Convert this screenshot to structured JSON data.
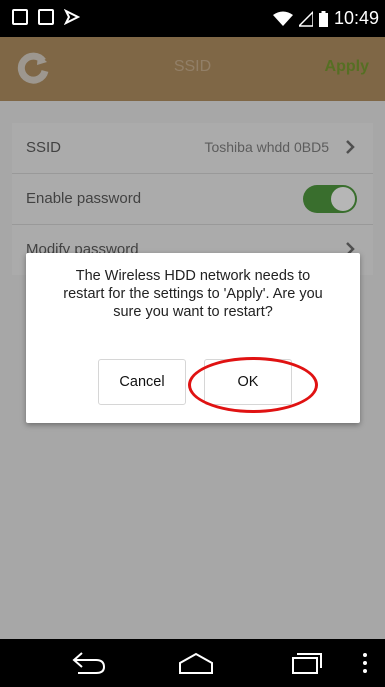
{
  "status_bar": {
    "time": "10:49"
  },
  "app_bar": {
    "title": "SSID",
    "action_label": "Apply"
  },
  "settings": {
    "ssid_label": "SSID",
    "ssid_value": "Toshiba whdd 0BD5",
    "enable_password_label": "Enable password",
    "enable_password_on": true,
    "modify_password_label": "Modify password"
  },
  "dialog": {
    "message": "The Wireless HDD network needs to restart for the settings to 'Apply'. Are you sure you want to restart?",
    "cancel_label": "Cancel",
    "ok_label": "OK"
  },
  "colors": {
    "app_bar": "#a3855a",
    "toggle_on": "#4a8d3a",
    "highlight": "#e01212"
  },
  "icons": [
    "gallery-icon",
    "sd-card-icon",
    "flag-icon",
    "wifi-icon",
    "signal-icon",
    "battery-icon",
    "refresh-logo-icon",
    "chevron-right-icon",
    "back-icon",
    "home-icon",
    "recents-icon",
    "overflow-menu-icon"
  ]
}
